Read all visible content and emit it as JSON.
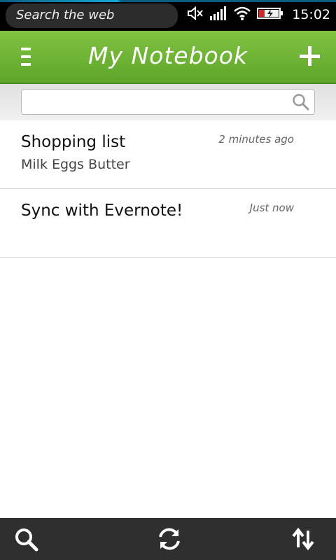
{
  "status_bar": {
    "search_placeholder": "Search the web",
    "time": "15:02",
    "icons": [
      "mute-icon",
      "signal-icon",
      "wifi-icon",
      "battery-charging-icon"
    ]
  },
  "header": {
    "title": "My Notebook",
    "menu_icon": "menu-icon",
    "add_icon": "add-icon"
  },
  "search": {
    "placeholder": "",
    "value": "",
    "icon": "search-icon"
  },
  "notes": [
    {
      "title": "Shopping list",
      "preview": "Milk Eggs Butter",
      "time": "2 minutes ago"
    },
    {
      "title": "Sync with Evernote!",
      "preview": "",
      "time": "Just now"
    }
  ],
  "toolbar": {
    "items": [
      "search-icon",
      "sync-icon",
      "sort-icon"
    ]
  },
  "colors": {
    "header_green": "#6fb537",
    "toolbar_dark": "#2f2f2f",
    "status_black": "#000000"
  }
}
